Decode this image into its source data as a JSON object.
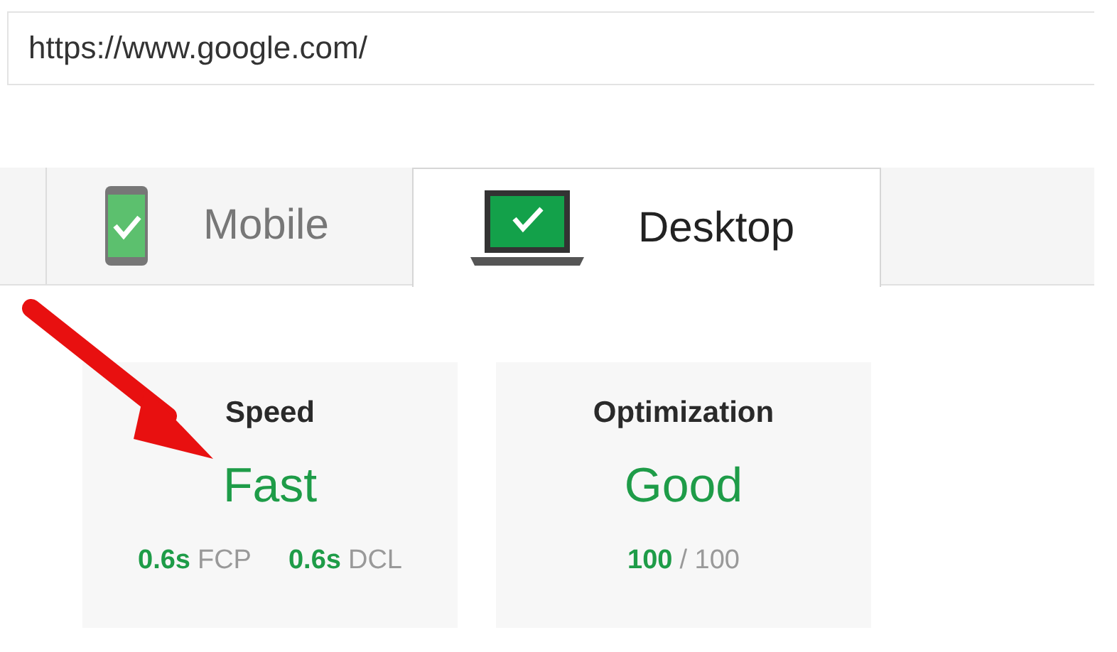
{
  "url_field": {
    "value": "https://www.google.com/"
  },
  "tabs": [
    {
      "label": "Mobile",
      "kind": "phone",
      "selected": false
    },
    {
      "label": "Desktop",
      "kind": "laptop",
      "selected": true
    }
  ],
  "cards": [
    {
      "title": "Speed",
      "rating": "Fast",
      "metrics": [
        {
          "value": "0.6s",
          "unit": "FCP"
        },
        {
          "value": "0.6s",
          "unit": "DCL"
        }
      ]
    },
    {
      "title": "Optimization",
      "rating": "Good",
      "metrics": [
        {
          "value": "100",
          "unit": "/ 100"
        }
      ]
    }
  ],
  "annotation": {
    "kind": "arrow"
  }
}
